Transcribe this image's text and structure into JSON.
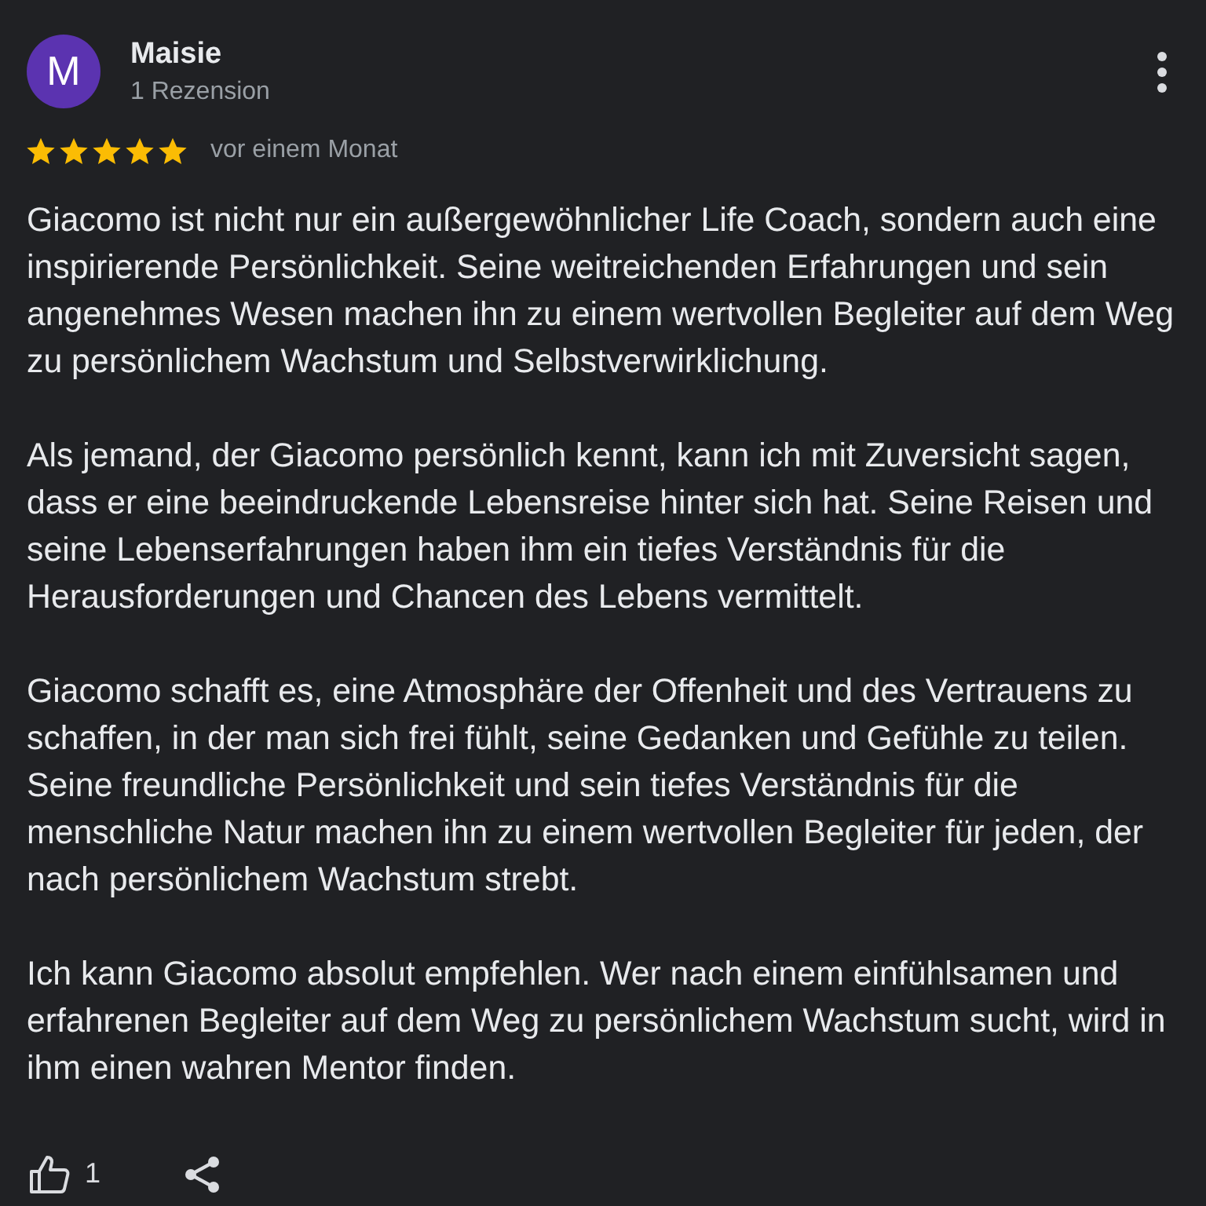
{
  "reviewer": {
    "initial": "M",
    "name": "Maisie",
    "review_count": "1 Rezension"
  },
  "review": {
    "stars": 5,
    "time": "vor einem Monat",
    "paragraphs": [
      "Giacomo ist nicht nur ein außergewöhnlicher Life Coach, sondern auch eine inspirierende Persönlichkeit. Seine weitreichenden Erfahrungen und sein angenehmes Wesen machen ihn zu einem wertvollen Begleiter auf dem Weg zu persönlichem Wachstum und Selbstverwirklichung.",
      "Als jemand, der Giacomo persönlich kennt, kann ich mit Zuversicht sagen, dass er eine beeindruckende Lebensreise hinter sich hat. Seine Reisen und seine Lebenserfahrungen haben ihm ein tiefes Verständnis für die Herausforderungen und Chancen des Lebens vermittelt.",
      "Giacomo schafft es, eine Atmosphäre der Offenheit und des Vertrauens zu schaffen, in der man sich frei fühlt, seine Gedanken und Gefühle zu teilen. Seine freundliche Persönlichkeit und sein tiefes Verständnis für die menschliche Natur machen ihn zu einem wertvollen Begleiter für jeden, der nach persönlichem Wachstum strebt.",
      "Ich kann Giacomo absolut empfehlen. Wer nach einem einfühlsamen und erfahrenen Begleiter auf dem Weg zu persönlichem Wachstum sucht, wird in ihm einen wahren Mentor finden."
    ]
  },
  "actions": {
    "like_count": "1"
  }
}
